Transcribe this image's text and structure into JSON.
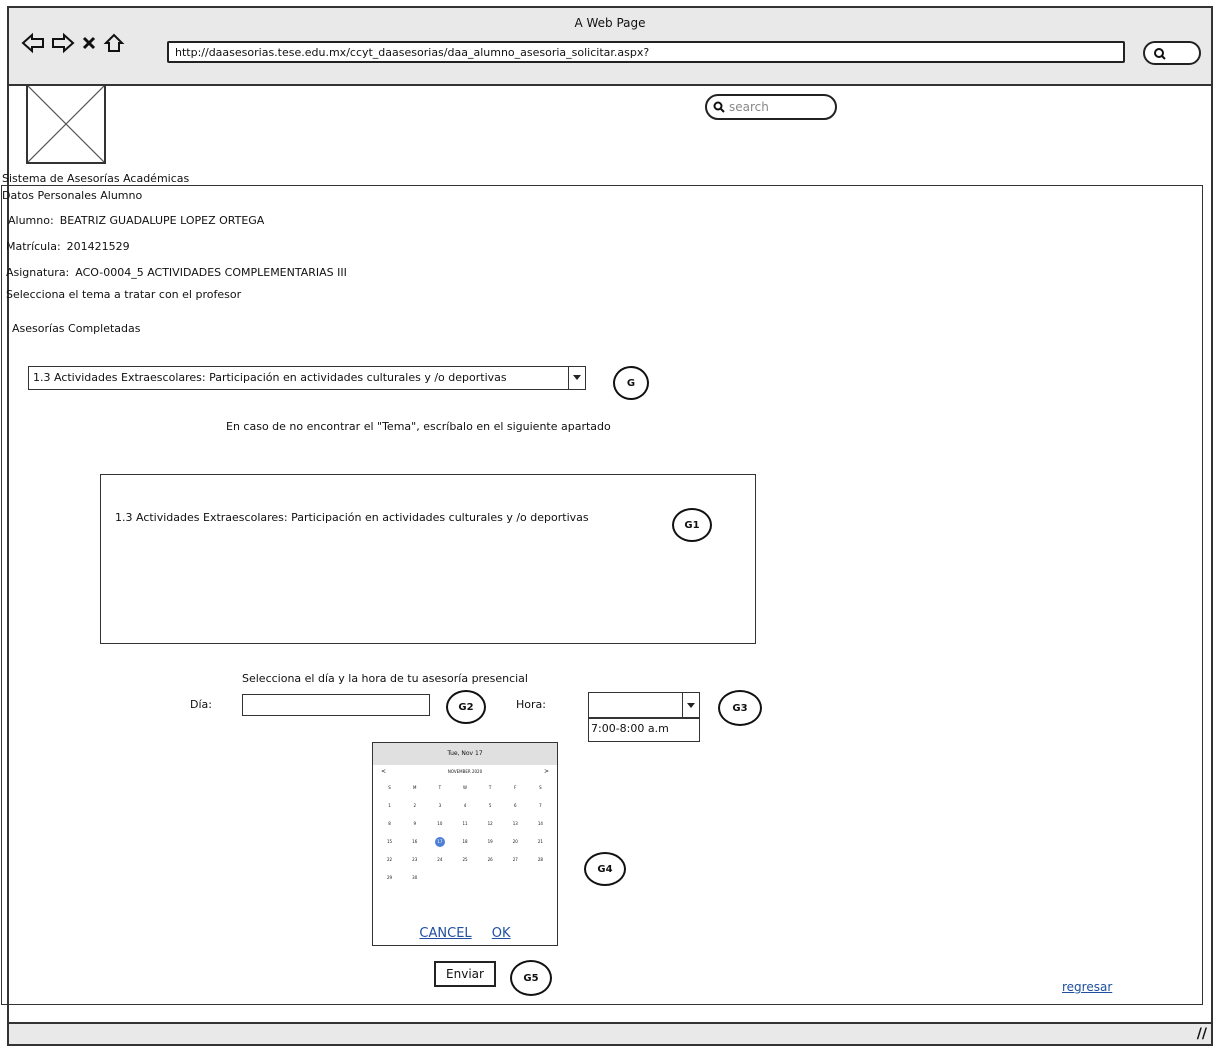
{
  "window": {
    "title": "A Web Page",
    "url": "http://daasesorias.tese.edu.mx/ccyt_daasesorias/daa_alumno_asesoria_solicitar.aspx?"
  },
  "header": {
    "search_placeholder": "search",
    "system_title": "Sistema de Asesorías Académicas"
  },
  "student": {
    "section_title": "Datos Personales Alumno",
    "alumno_label": "Alumno:",
    "alumno_value": "BEATRIZ GUADALUPE LOPEZ ORTEGA",
    "matricula_label": "Matrícula:",
    "matricula_value": "201421529",
    "asignatura_label": "Asignatura:",
    "asignatura_value": "ACO-0004_5 ACTIVIDADES COMPLEMENTARIAS III"
  },
  "topic": {
    "instruction": "Selecciona el tema a tratar con el profesor",
    "completed_label": "Asesorías Completadas",
    "selected": "1.3 Actividades Extraescolares: Participación en actividades culturales y /o deportivas",
    "hint": "En caso de no encontrar el \"Tema\", escríbalo en el siguiente apartado",
    "text_value": "1.3 Actividades Extraescolares: Participación en actividades culturales y /o deportivas"
  },
  "schedule": {
    "instruction": "Selecciona el día y la hora de tu asesoría presencial",
    "dia_label": "Día:",
    "hora_label": "Hora:",
    "hora_option": "7:00-8:00 a.m"
  },
  "calendar": {
    "header": "Tue, Nov 17",
    "month": "NOVEMBER 2020",
    "prev": "<",
    "next": ">",
    "weekdays": [
      "S",
      "M",
      "T",
      "W",
      "T",
      "F",
      "S"
    ],
    "days": [
      "1",
      "2",
      "3",
      "4",
      "5",
      "6",
      "7",
      "8",
      "9",
      "10",
      "11",
      "12",
      "13",
      "14",
      "15",
      "16",
      "17",
      "18",
      "19",
      "20",
      "21",
      "22",
      "23",
      "24",
      "25",
      "26",
      "27",
      "28",
      "29",
      "30"
    ],
    "selected_day": "17",
    "cancel": "CANCEL",
    "ok": "OK"
  },
  "badges": {
    "g": "G",
    "g1": "G1",
    "g2": "G2",
    "g3": "G3",
    "g4": "G4",
    "g5": "G5"
  },
  "actions": {
    "submit": "Enviar",
    "back": "regresar"
  }
}
